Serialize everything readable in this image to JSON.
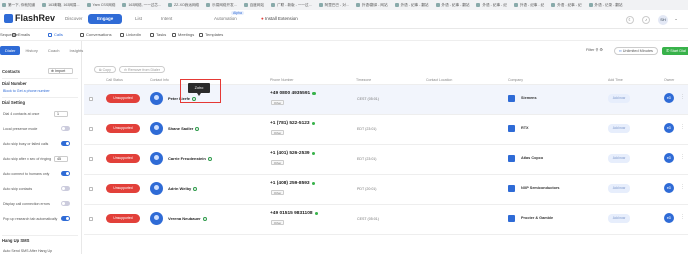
{
  "bookmarks": [
    "第一下, 你就知道",
    "163邮箱, 163网易...",
    "Yarn CSS网络",
    "163网络, 一一过芯...",
    "ZZ-XO我远网络",
    "乐易网络开发...",
    "百度网站",
    "广联 - 新版 - 一一过...",
    "阿里巴巴 - 对...",
    "外语/翻译 - 网站",
    "外语 - 纪事 - 翻站",
    "外语 - 纪事 - 翻站",
    "外语 - 纪事 - 纪",
    "外语 - 纪事 - 纪",
    "外语 - 纪事 - 纪",
    "外语 - 记录 - 翻站"
  ],
  "app": {
    "name": "FlashRev",
    "brand_color": "#2f6bd6"
  },
  "top_nav": [
    {
      "label": "Discover",
      "active": false
    },
    {
      "label": "Engage",
      "active": true
    },
    {
      "label": "List",
      "active": false
    },
    {
      "label": "Intent",
      "active": false
    },
    {
      "label": "Automation",
      "active": false
    },
    {
      "label": "Install Extension",
      "active": false
    }
  ],
  "alpha_badge": "Alpha",
  "user_initials": "SH",
  "sub_nav": [
    {
      "label": "Sequence",
      "icon": "sequence-icon"
    },
    {
      "label": "Emails",
      "icon": "email-icon"
    },
    {
      "label": "Calls",
      "icon": "phone-icon",
      "selected": true
    },
    {
      "label": "Conversations",
      "icon": "chat-icon"
    },
    {
      "label": "LinkedIn",
      "icon": "linkedin-icon"
    },
    {
      "label": "Tasks",
      "icon": "tasks-icon"
    },
    {
      "label": "Meetings",
      "icon": "meetings-icon"
    },
    {
      "label": "Templates",
      "icon": "templates-icon"
    }
  ],
  "side_tabs": [
    "Dialer",
    "History",
    "Coach",
    "Insights"
  ],
  "sidebar": {
    "contacts_label": "Contacts",
    "import_label": "Import",
    "dial_number_label": "Dial Number",
    "dial_number_value": "Block to Get a phone number",
    "dial_setting_label": "Dial Setting",
    "settings": [
      {
        "label": "Dial 4 contacts at once",
        "control": "select",
        "value": "1"
      },
      {
        "label": "Local presence mode",
        "control": "toggle",
        "on": false
      },
      {
        "label": "Auto skip busy or failed calls",
        "control": "toggle",
        "on": true
      },
      {
        "label": "Auto skip after x sec of ringing",
        "control": "select",
        "value": "45"
      },
      {
        "label": "Auto connect to humans only",
        "control": "toggle",
        "on": true
      },
      {
        "label": "Auto skip contacts",
        "control": "toggle",
        "on": false
      },
      {
        "label": "Display call connection errors",
        "control": "toggle",
        "on": false
      },
      {
        "label": "Pop up research tab automatically",
        "control": "toggle",
        "on": true
      }
    ],
    "hang_up_label": "Hang Up SMS",
    "hang_up_setting": "Auto Send SMS After Hang Up"
  },
  "toolbar": {
    "filter_label": "Filter",
    "unlimited_label": "Unlimited Minutes",
    "start_label": "Start Dial"
  },
  "actions": {
    "copy_label": "Copy",
    "remove_label": "Remove from Dialer"
  },
  "columns": [
    "Call Status",
    "Contact Info",
    "Phone Number",
    "Timezone",
    "Contact Location",
    "Company",
    "Add Time",
    "Owner"
  ],
  "rows": [
    {
      "status": "Unsupported",
      "name": "Peter Lierfe",
      "phone": "+49 0800 4935591",
      "tag": "Other",
      "timezone": "CEST (05:01)",
      "company": "Siemens",
      "add_time": "Add now",
      "owner": "eD",
      "highlight": true
    },
    {
      "status": "Unsupported",
      "name": "Shane Sadler",
      "phone": "+1 (781) 522-5123",
      "tag": "Other",
      "timezone": "EDT (23:01)",
      "company": "RTX",
      "add_time": "Add now",
      "owner": "eD"
    },
    {
      "status": "Unsupported",
      "name": "Carrie Freudenstein",
      "phone": "+1 (401) 526-2539",
      "tag": "Other",
      "timezone": "EDT (23:01)",
      "company": "Atlas Copco",
      "add_time": "Add now",
      "owner": "eD"
    },
    {
      "status": "Unsupported",
      "name": "Adrin Welby",
      "phone": "+1 (408) 259-8593",
      "tag": "Other",
      "timezone": "PDT (20:01)",
      "company": "NXP Semiconductors",
      "add_time": "Add now",
      "owner": "eD"
    },
    {
      "status": "Unsupported",
      "name": "Verena Neubauer",
      "phone": "+49 01515 9831108",
      "tag": "Other",
      "timezone": "CEST (05:01)",
      "company": "Procter & Gamble",
      "add_time": "Add now",
      "owner": "eD"
    }
  ],
  "tooltip": "Zoho",
  "colors": {
    "status_red": "#e2403a",
    "accent_green": "#38b24a",
    "highlight": "#e53935"
  }
}
